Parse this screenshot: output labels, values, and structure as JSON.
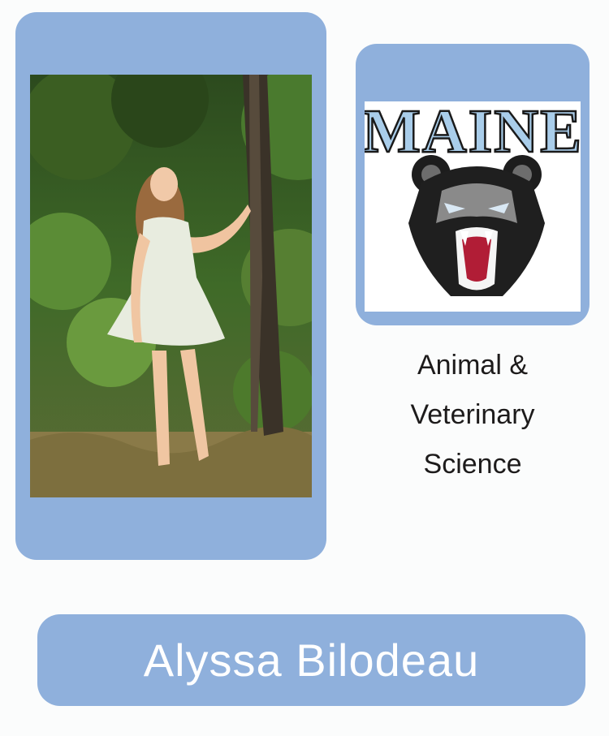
{
  "student": {
    "name": "Alyssa Bilodeau",
    "major_lines": [
      "Animal &",
      "Veterinary",
      "Science"
    ]
  },
  "logo": {
    "wordmark": "MAINE",
    "wordmark_color": "#a9cdea",
    "outline_color": "#1a1a1a"
  },
  "colors": {
    "card": "#8fb0dc",
    "background": "#fbfcfc"
  }
}
